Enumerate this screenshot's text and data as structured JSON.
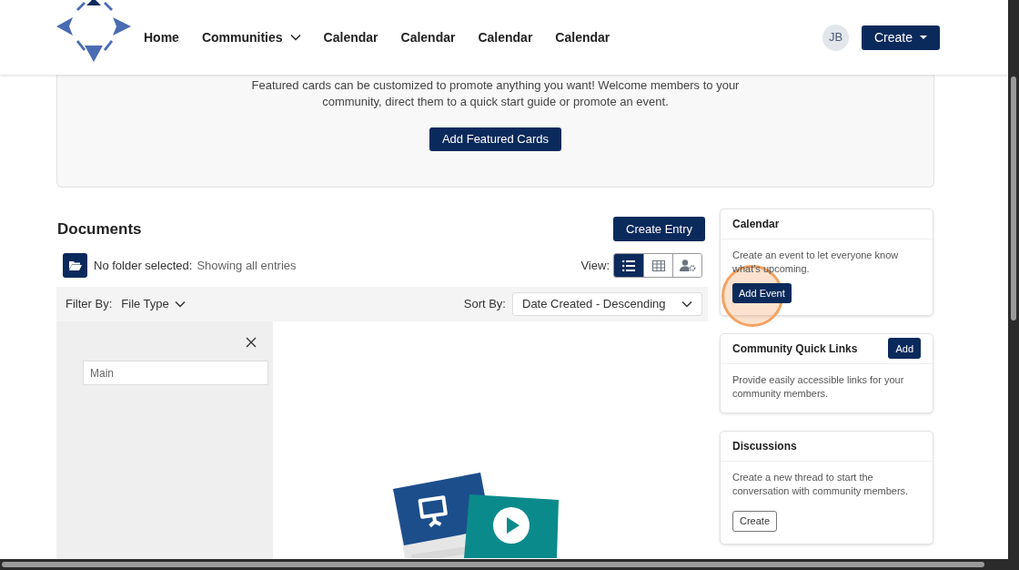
{
  "header": {
    "nav": [
      {
        "label": "Home",
        "kind": "link"
      },
      {
        "label": "Communities",
        "kind": "dropdown"
      },
      {
        "label": "Calendar",
        "kind": "link"
      },
      {
        "label": "Calendar",
        "kind": "link"
      },
      {
        "label": "Calendar",
        "kind": "link"
      },
      {
        "label": "Calendar",
        "kind": "link"
      }
    ],
    "avatar": "JB",
    "create_button": "Create"
  },
  "featured": {
    "text": "Featured cards can be customized to promote anything you want! Welcome members to your community, direct them to a quick start guide or promote an event.",
    "button": "Add Featured Cards"
  },
  "documents": {
    "title": "Documents",
    "create_button": "Create Entry",
    "folder_label": "No folder selected:",
    "folder_value": "Showing all entries",
    "view_label": "View:",
    "views": [
      {
        "kind": "list",
        "selected": true
      },
      {
        "kind": "grid",
        "selected": false
      },
      {
        "kind": "user-settings",
        "selected": false
      }
    ],
    "filter_label": "Filter By:",
    "filter_value": "File Type",
    "sort_label": "Sort By:",
    "sort_value": "Date Created - Descending",
    "folder_search_placeholder": "Main"
  },
  "sidebar": [
    {
      "title": "Calendar",
      "text": "Create an event to let everyone know what's upcoming.",
      "button": "Add Event",
      "kind": "solid",
      "highlighted": true
    },
    {
      "title": "Community Quick Links",
      "text": "Provide easily accessible links for your community members.",
      "button": "Add",
      "kind": "header",
      "highlighted": false
    },
    {
      "title": "Discussions",
      "text": "Create a new thread to start the conversation with community members.",
      "button": "Create",
      "kind": "outline",
      "highlighted": false
    }
  ]
}
